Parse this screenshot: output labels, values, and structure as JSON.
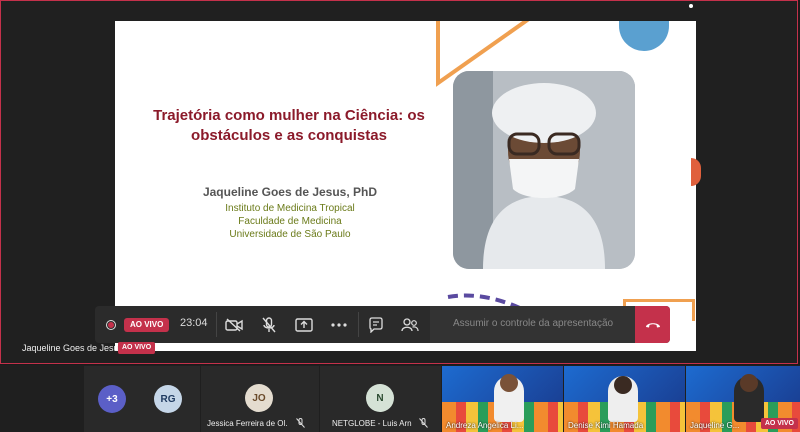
{
  "slide": {
    "title": "Trajetória como mulher na Ciência: os obstáculos e as conquistas",
    "author": "Jaqueline Goes de Jesus, PhD",
    "affiliations": [
      "Instituto de Medicina Tropical",
      "Faculdade de Medicina",
      "Universidade de São Paulo"
    ]
  },
  "controls": {
    "live_label": "AO VIVO",
    "timer": "23:04",
    "take_control_label": "Assumir o controle da apresentação"
  },
  "presenter": {
    "name": "Jaqueline Goes de Jesus",
    "live_label": "AO VIVO"
  },
  "participants": {
    "overflow_count": "+3",
    "tiles": [
      {
        "initials": "RG",
        "name": ""
      },
      {
        "initials": "JO",
        "name": "Jessica Ferreira de Ol..."
      },
      {
        "initials": "N",
        "name": "NETGLOBE - Luis Arn..."
      }
    ],
    "videos": [
      {
        "name": "Andreza Angelica Li..."
      },
      {
        "name": "Denise Kimi Hamada"
      },
      {
        "name": "Jaqueline G...",
        "live_label": "AO VIVO"
      }
    ]
  },
  "colors": {
    "accent_red": "#c4314b",
    "title_red": "#8b1a2a",
    "affiliation_green": "#6b7b1a"
  }
}
